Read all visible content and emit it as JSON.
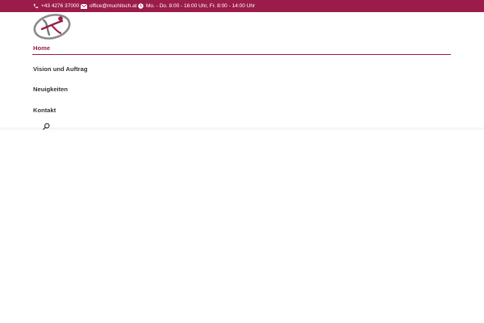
{
  "topbar": {
    "bg_color": "#9b1c4a",
    "phone": {
      "icon": "phone-icon",
      "text": "+43 4276 37000"
    },
    "email": {
      "icon": "envelope-icon",
      "text": "office@muchitsch.at"
    },
    "hours": {
      "icon": "clock-icon",
      "text": "Mo. - Do. 8:00 - 16:00 Uhr, Fr. 8:00 - 14:00 Uhr"
    }
  },
  "logo": {
    "icon": "site-logo"
  },
  "nav": {
    "accent_color": "#9b1c4a",
    "items": [
      {
        "label": "Home",
        "active": true
      },
      {
        "label": "Vision und Auftrag",
        "active": false
      },
      {
        "label": "Neuigkeiten",
        "active": false
      },
      {
        "label": "Kontakt",
        "active": false
      }
    ]
  },
  "search": {
    "icon": "search-icon"
  }
}
